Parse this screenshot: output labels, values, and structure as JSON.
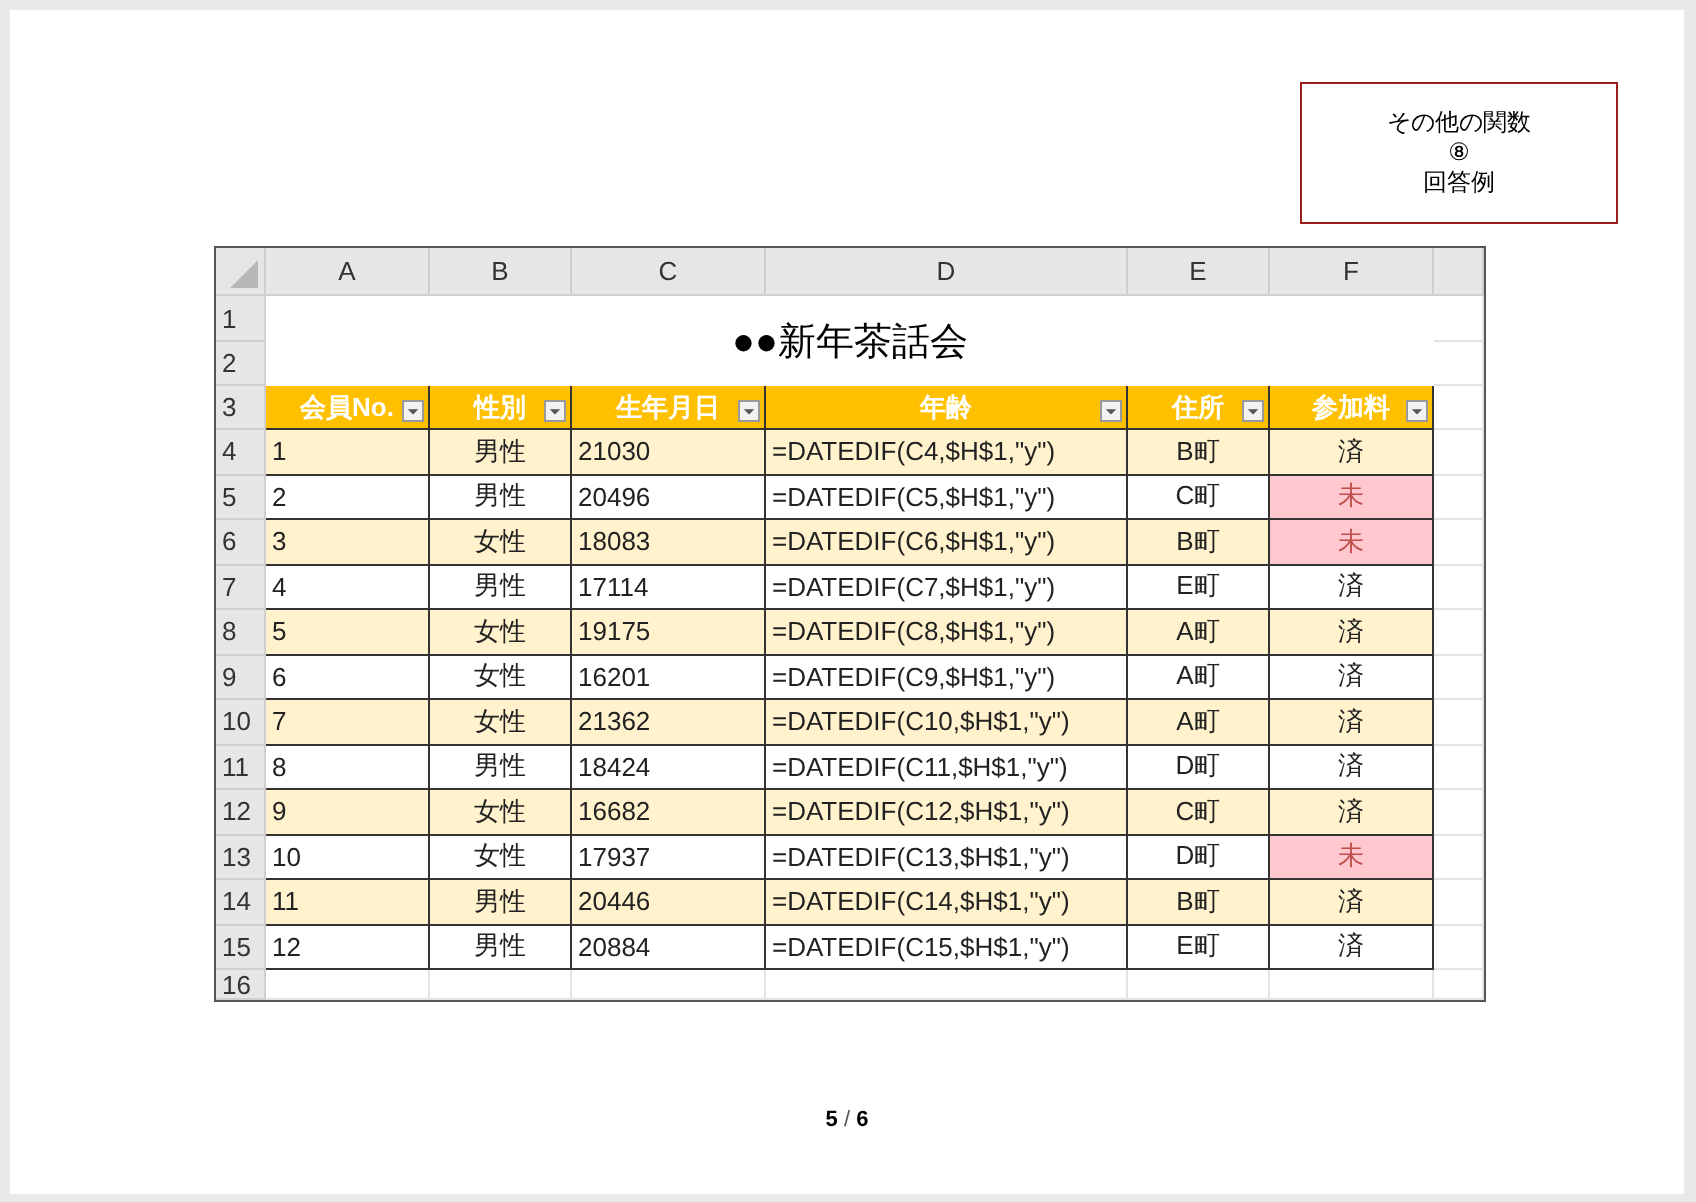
{
  "title_box": [
    "その他の関数",
    "⑧",
    "回答例"
  ],
  "sheet": {
    "column_headers": [
      "A",
      "B",
      "C",
      "D",
      "E",
      "F"
    ],
    "row_numbers": [
      "1",
      "2",
      "3",
      "4",
      "5",
      "6",
      "7",
      "8",
      "9",
      "10",
      "11",
      "12",
      "13",
      "14",
      "15",
      "16"
    ],
    "title": "●●新年茶話会",
    "columns": [
      "会員No.",
      "性別",
      "生年月日",
      "年齢",
      "住所",
      "参加料"
    ],
    "rows": [
      {
        "cells": [
          "1",
          "男性",
          "21030",
          "=DATEDIF(C4,$H$1,\"y\")",
          "B町",
          "済"
        ],
        "paid": true
      },
      {
        "cells": [
          "2",
          "男性",
          "20496",
          "=DATEDIF(C5,$H$1,\"y\")",
          "C町",
          "未"
        ],
        "paid": false
      },
      {
        "cells": [
          "3",
          "女性",
          "18083",
          "=DATEDIF(C6,$H$1,\"y\")",
          "B町",
          "未"
        ],
        "paid": false
      },
      {
        "cells": [
          "4",
          "男性",
          "17114",
          "=DATEDIF(C7,$H$1,\"y\")",
          "E町",
          "済"
        ],
        "paid": true
      },
      {
        "cells": [
          "5",
          "女性",
          "19175",
          "=DATEDIF(C8,$H$1,\"y\")",
          "A町",
          "済"
        ],
        "paid": true
      },
      {
        "cells": [
          "6",
          "女性",
          "16201",
          "=DATEDIF(C9,$H$1,\"y\")",
          "A町",
          "済"
        ],
        "paid": true
      },
      {
        "cells": [
          "7",
          "女性",
          "21362",
          "=DATEDIF(C10,$H$1,\"y\")",
          "A町",
          "済"
        ],
        "paid": true
      },
      {
        "cells": [
          "8",
          "男性",
          "18424",
          "=DATEDIF(C11,$H$1,\"y\")",
          "D町",
          "済"
        ],
        "paid": true
      },
      {
        "cells": [
          "9",
          "女性",
          "16682",
          "=DATEDIF(C12,$H$1,\"y\")",
          "C町",
          "済"
        ],
        "paid": true
      },
      {
        "cells": [
          "10",
          "女性",
          "17937",
          "=DATEDIF(C13,$H$1,\"y\")",
          "D町",
          "未"
        ],
        "paid": false
      },
      {
        "cells": [
          "11",
          "男性",
          "20446",
          "=DATEDIF(C14,$H$1,\"y\")",
          "B町",
          "済"
        ],
        "paid": true
      },
      {
        "cells": [
          "12",
          "男性",
          "20884",
          "=DATEDIF(C15,$H$1,\"y\")",
          "E町",
          "済"
        ],
        "paid": true
      }
    ]
  },
  "page_number": "**5** / **6**"
}
